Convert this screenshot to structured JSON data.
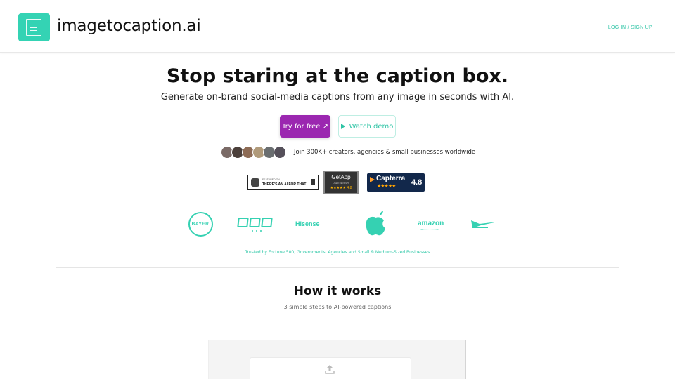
{
  "header": {
    "brand": "imagetocaption.ai",
    "auth_link": "LOG IN / SIGN UP"
  },
  "hero": {
    "title": "Stop staring at the caption box.",
    "subtitle": "Generate on-brand social-media captions from any image in seconds with AI.",
    "cta_primary": "Try for free ↗",
    "cta_secondary": "Watch demo",
    "social_proof": "Join 300K+ creators, agencies & small businesses worldwide",
    "avatars": [
      "#7a6a66",
      "#4b3f3a",
      "#8d6b55",
      "#b09a7a",
      "#6a6e70",
      "#55505a"
    ]
  },
  "badges": {
    "aift_top": "FEATURED ON",
    "aift_name": "THERE'S AN AI FOR THAT",
    "getapp_name": "GetApp",
    "getapp_sub": "USER REVIEWS",
    "getapp_rating": "★★★★★ 4.8",
    "capterra_name": "Capterra",
    "capterra_stars": "★★★★★",
    "capterra_score": "4.8"
  },
  "logos": {
    "bayer_text": "BAYER",
    "hisense": "Hisense",
    "amazon": "amazon"
  },
  "trusted_text": "Trusted by Fortune 500, Governments, Agencies and Small & Medium-Sized Businesses",
  "how": {
    "title": "How it works",
    "subtitle": "3 simple steps to AI-powered captions"
  },
  "colors": {
    "accent": "#34d3b4",
    "primary_button": "#9b27b0"
  }
}
